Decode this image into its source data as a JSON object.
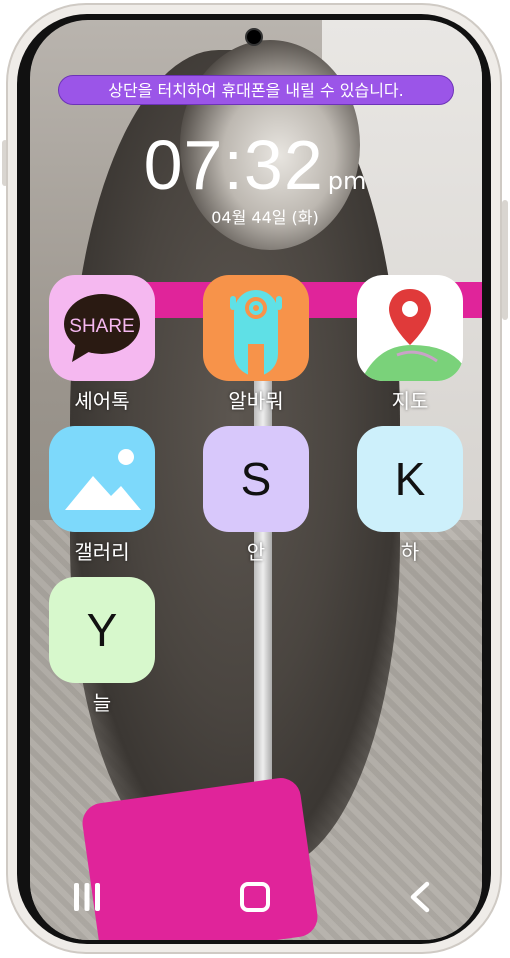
{
  "banner": {
    "text": "상단을 터치하여 휴대폰을 내릴 수 있습니다."
  },
  "clock": {
    "time": "07:32",
    "ampm": "pm",
    "date": "04월 44일 (화)"
  },
  "apps": [
    {
      "label": "셰어톡",
      "icon": "share-chat-icon",
      "icon_text": "SHARE",
      "bg": "#f5b8f0"
    },
    {
      "label": "알바뭐",
      "icon": "robot-mascot-icon",
      "bg": "#f7934a"
    },
    {
      "label": "지도",
      "icon": "map-pin-icon",
      "bg": "#ffffff"
    },
    {
      "label": "갤러리",
      "icon": "image-gallery-icon",
      "bg": "#7dd9fb"
    },
    {
      "label": "안",
      "icon": "letter-s-icon",
      "letter": "S",
      "bg": "#d8c8fb"
    },
    {
      "label": "하",
      "icon": "letter-k-icon",
      "letter": "K",
      "bg": "#cdf0fb"
    },
    {
      "label": "늘",
      "icon": "letter-y-icon",
      "letter": "Y",
      "bg": "#d7f8cc"
    }
  ],
  "navbar": {
    "recent": "recent-apps-icon",
    "home": "home-icon",
    "back": "back-icon"
  }
}
